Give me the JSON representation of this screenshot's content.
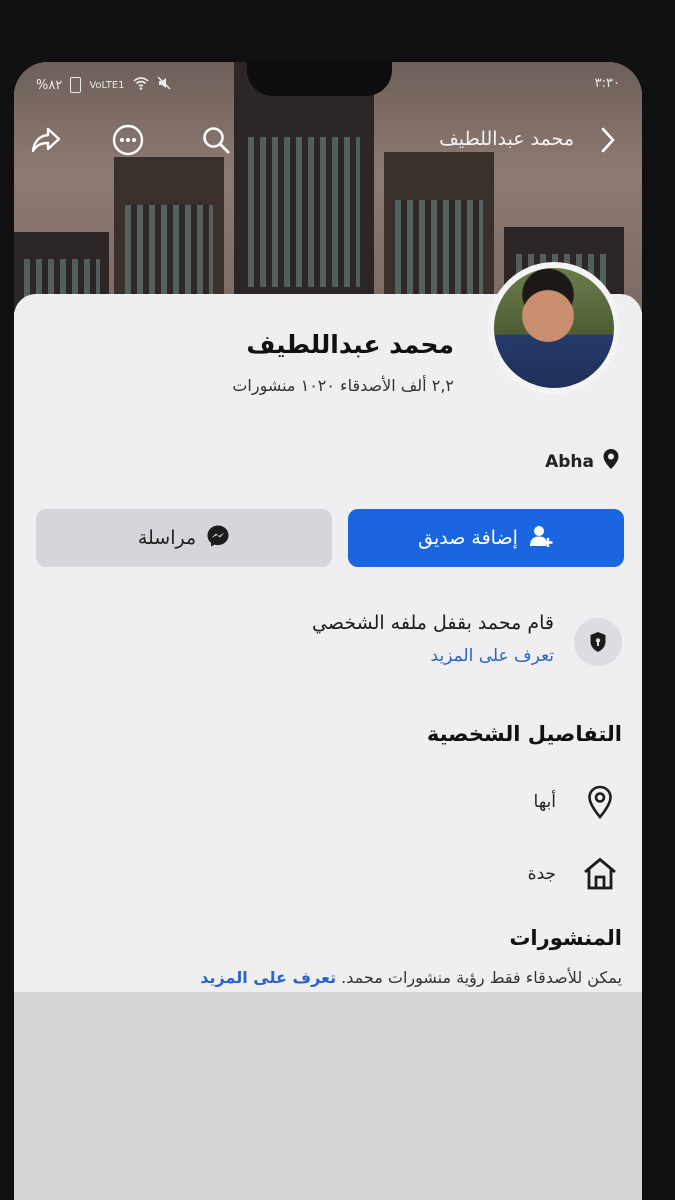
{
  "status_bar": {
    "battery": "%٨٢",
    "network": "VoLTE1",
    "time": "٣:٣٠"
  },
  "header": {
    "title": "محمد عبداللطيف",
    "icons": [
      "share-icon",
      "more-icon",
      "search-icon",
      "chevron-right-icon"
    ]
  },
  "profile": {
    "name": "محمد عبداللطيف",
    "stats": "٢,٢ ألف الأصدقاء ١٠٢٠ منشورات",
    "location": "Abha"
  },
  "actions": {
    "add_friend_label": "إضافة صديق",
    "message_label": "مراسلة",
    "accent_color": "#1a66e0"
  },
  "locked_notice": {
    "text": "قام محمد بقفل ملفه الشخصي",
    "link": "تعرف على المزيد"
  },
  "details": {
    "title": "التفاصيل الشخصية",
    "items": [
      {
        "icon": "map-pin-icon",
        "text": "أبها"
      },
      {
        "icon": "home-icon",
        "text": "جدة"
      }
    ]
  },
  "posts": {
    "title": "المنشورات",
    "note": "يمكن للأصدقاء فقط رؤية منشورات محمد.",
    "link": "تعرف على المزيد"
  }
}
